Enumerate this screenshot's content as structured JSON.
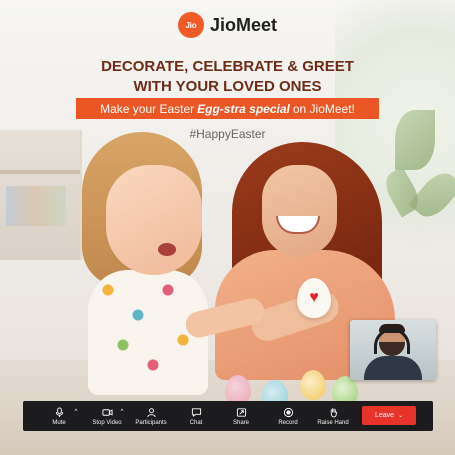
{
  "brand": {
    "logo_text": "Jio",
    "name": "JioMeet",
    "color": "#ef5a25"
  },
  "headline": {
    "line1": "DECORATE, CELEBRATE & GREET",
    "line2": "WITH YOUR LOVED ONES",
    "color": "#6c2c16"
  },
  "tagline": {
    "prefix": "Make your Easter",
    "emphasis": "Egg-stra special",
    "suffix": "on JioMeet!",
    "background": "#ea5624"
  },
  "hashtag": "#HappyEaster",
  "self_view": {
    "icon": "self-view-video"
  },
  "toolbar": {
    "background": "#1c1c1f",
    "buttons": [
      {
        "id": "mute",
        "label": "Mute",
        "icon": "microphone-icon",
        "has_menu": true
      },
      {
        "id": "stop-video",
        "label": "Stop Video",
        "icon": "video-camera-icon",
        "has_menu": true
      },
      {
        "id": "participants",
        "label": "Participants",
        "icon": "participants-icon",
        "has_menu": false
      },
      {
        "id": "chat",
        "label": "Chat",
        "icon": "chat-bubble-icon",
        "has_menu": false
      },
      {
        "id": "share",
        "label": "Share",
        "icon": "share-screen-icon",
        "has_menu": false
      },
      {
        "id": "record",
        "label": "Record",
        "icon": "record-icon",
        "has_menu": false
      },
      {
        "id": "raise-hand",
        "label": "Raise Hand",
        "icon": "raise-hand-icon",
        "has_menu": false
      }
    ],
    "leave": {
      "label": "Leave",
      "icon": "chevron-down-icon",
      "color": "#e8332a"
    }
  }
}
